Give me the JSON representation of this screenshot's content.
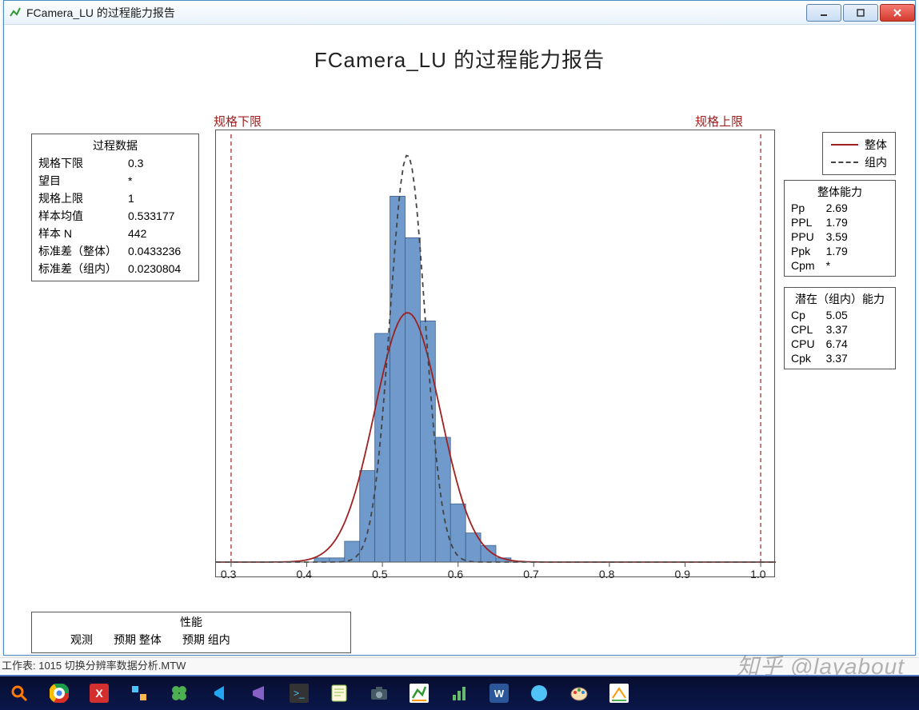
{
  "window": {
    "title": "FCamera_LU 的过程能力报告"
  },
  "chart": {
    "title": "FCamera_LU 的过程能力报告"
  },
  "labels": {
    "lsl": "规格下限",
    "usl": "规格上限"
  },
  "process_data": {
    "header": "过程数据",
    "rows": [
      {
        "k": "规格下限",
        "v": "0.3"
      },
      {
        "k": "望目",
        "v": "*"
      },
      {
        "k": "规格上限",
        "v": "1"
      },
      {
        "k": "样本均值",
        "v": "0.533177"
      },
      {
        "k": "样本 N",
        "v": "442"
      },
      {
        "k": "标准差（整体）",
        "v": "0.0433236"
      },
      {
        "k": "标准差（组内）",
        "v": "0.0230804"
      }
    ]
  },
  "legend": {
    "overall": "整体",
    "within": "组内"
  },
  "overall_cap": {
    "header": "整体能力",
    "rows": [
      {
        "k": "Pp",
        "v": "2.69"
      },
      {
        "k": "PPL",
        "v": "1.79"
      },
      {
        "k": "PPU",
        "v": "3.59"
      },
      {
        "k": "Ppk",
        "v": "1.79"
      },
      {
        "k": "Cpm",
        "v": "*"
      }
    ]
  },
  "within_cap": {
    "header": "潜在（组内）能力",
    "rows": [
      {
        "k": "Cp",
        "v": "5.05"
      },
      {
        "k": "CPL",
        "v": "3.37"
      },
      {
        "k": "CPU",
        "v": "6.74"
      },
      {
        "k": "Cpk",
        "v": "3.37"
      }
    ]
  },
  "performance": {
    "header": "性能",
    "cols": [
      "",
      "观测",
      "预期 整体",
      "预期 组内"
    ]
  },
  "status": "工作表: 1015 切换分辨率数据分析.MTW",
  "watermark": "知乎 @layabout",
  "chart_data": {
    "type": "histogram+density",
    "xlabel": "",
    "ylabel": "",
    "xlim": [
      0.28,
      1.02
    ],
    "xticks": [
      0.3,
      0.4,
      0.5,
      0.6,
      0.7,
      0.8,
      0.9,
      1.0
    ],
    "lsl": 0.3,
    "usl": 1.0,
    "mean": 0.533177,
    "std_overall": 0.0433236,
    "std_within": 0.0230804,
    "bin_width": 0.02,
    "bins": [
      {
        "x": 0.4,
        "h": 0.0
      },
      {
        "x": 0.42,
        "h": 0.01
      },
      {
        "x": 0.44,
        "h": 0.01
      },
      {
        "x": 0.46,
        "h": 0.05
      },
      {
        "x": 0.48,
        "h": 0.22
      },
      {
        "x": 0.5,
        "h": 0.55
      },
      {
        "x": 0.52,
        "h": 0.88
      },
      {
        "x": 0.54,
        "h": 0.78
      },
      {
        "x": 0.56,
        "h": 0.58
      },
      {
        "x": 0.58,
        "h": 0.3
      },
      {
        "x": 0.6,
        "h": 0.14
      },
      {
        "x": 0.62,
        "h": 0.07
      },
      {
        "x": 0.64,
        "h": 0.04
      },
      {
        "x": 0.66,
        "h": 0.01
      }
    ],
    "curves": {
      "overall": {
        "type": "normal",
        "color": "#a02020",
        "style": "solid",
        "mean": 0.533177,
        "std": 0.0433236,
        "peak_rel": 0.6
      },
      "within": {
        "type": "normal",
        "color": "#444",
        "style": "dash",
        "mean": 0.533177,
        "std": 0.0230804,
        "peak_rel": 0.98
      }
    }
  },
  "colors": {
    "bar": "#6f9acb",
    "bar_edge": "#3d5f8a",
    "curve_overall": "#a02020",
    "curve_within": "#444",
    "lsl_usl": "#a02020"
  }
}
